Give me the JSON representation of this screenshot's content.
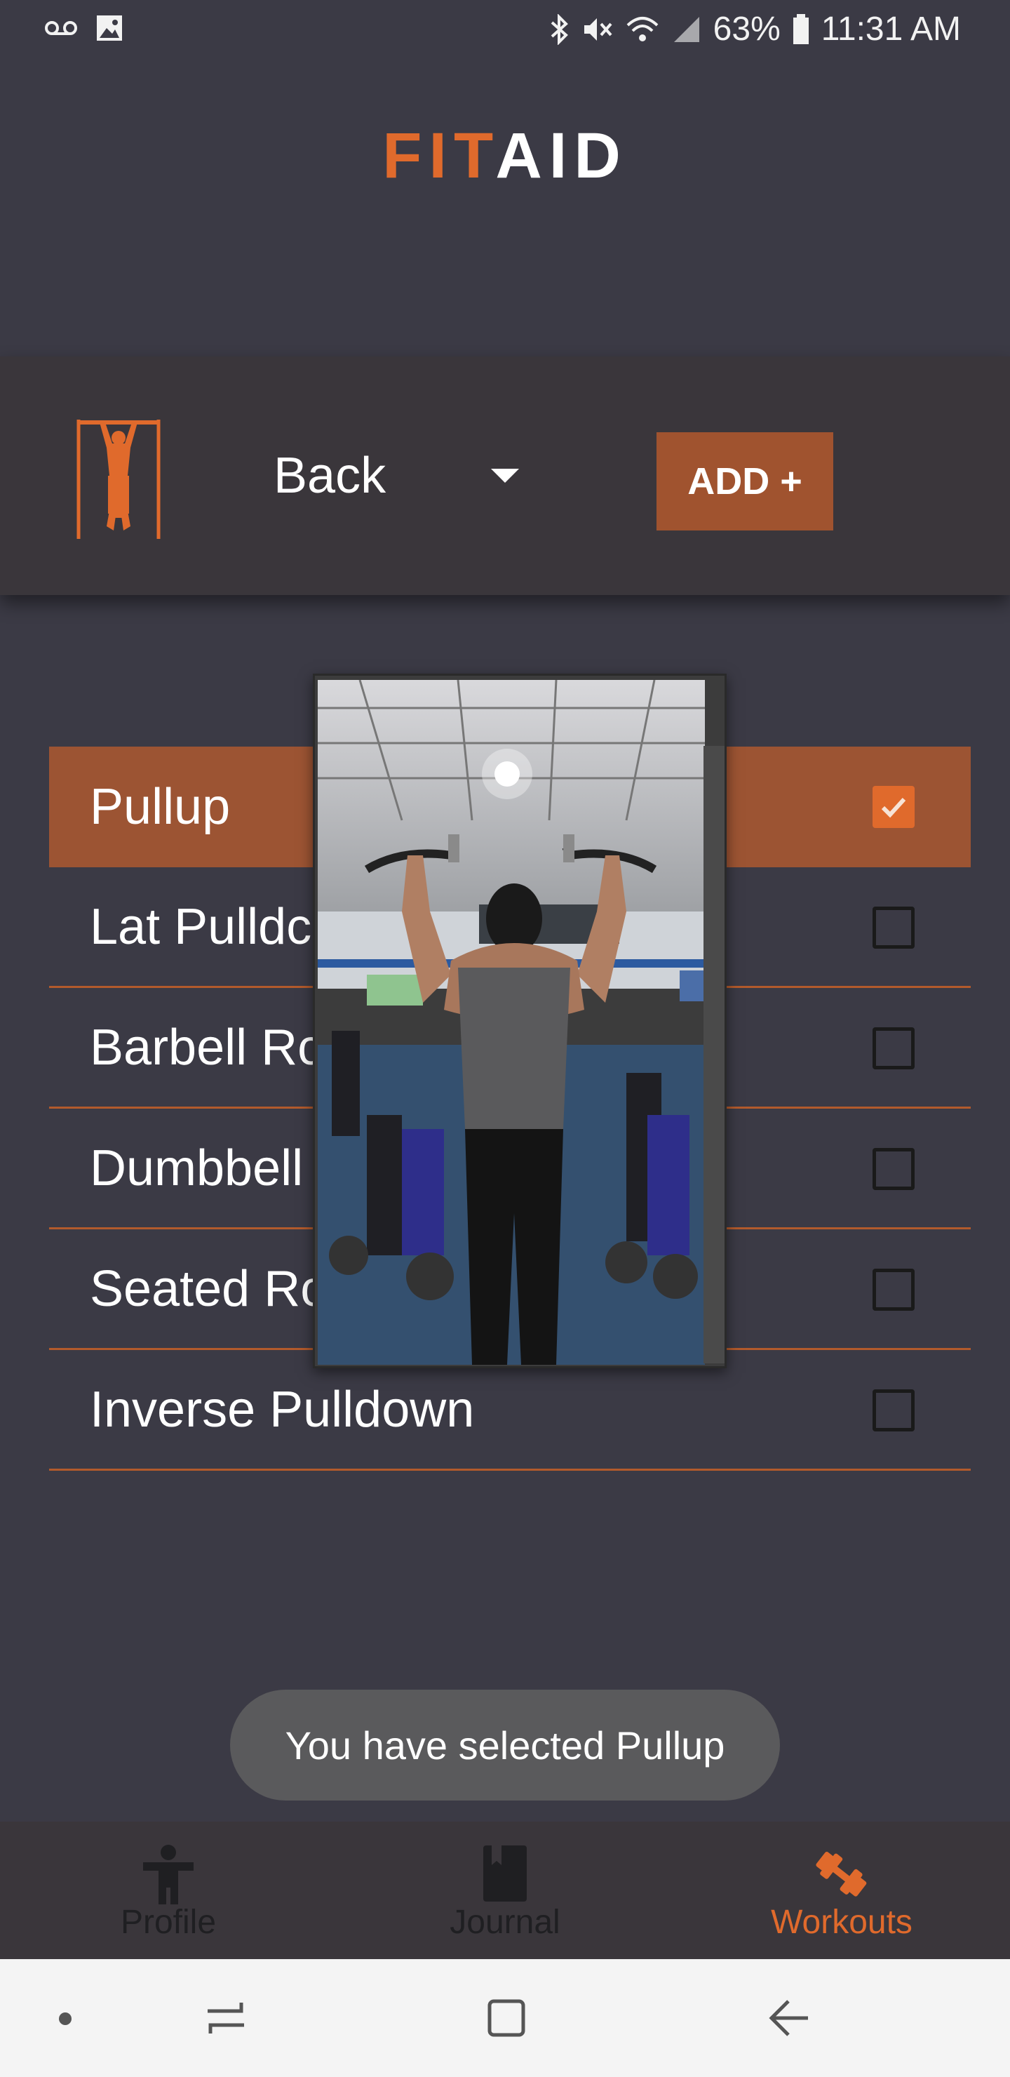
{
  "status_bar": {
    "battery_percent": "63%",
    "time": "11:31 AM",
    "icons": [
      "voicemail-icon",
      "image-icon",
      "bluetooth-icon",
      "mute-icon",
      "wifi-icon",
      "signal-icon",
      "battery-icon"
    ]
  },
  "app": {
    "logo_part1": "FIT",
    "logo_part2": "AID",
    "accent_color": "#e06a2c"
  },
  "header": {
    "category_value": "Back",
    "add_button_label": "ADD +"
  },
  "exercises": [
    {
      "label": "Pullup",
      "checked": true
    },
    {
      "label": "Lat Pulldc",
      "checked": false
    },
    {
      "label": "Barbell Rc",
      "checked": false
    },
    {
      "label": "Dumbbell",
      "checked": false
    },
    {
      "label": "Seated Rc",
      "checked": false
    },
    {
      "label": "Inverse Pulldown",
      "checked": false
    }
  ],
  "toast": {
    "message": "You have selected Pullup"
  },
  "bottom_nav": {
    "items": [
      {
        "label": "Profile",
        "icon": "person-icon",
        "active": false
      },
      {
        "label": "Journal",
        "icon": "book-icon",
        "active": false
      },
      {
        "label": "Workouts",
        "icon": "dumbbell-icon",
        "active": true
      }
    ]
  }
}
